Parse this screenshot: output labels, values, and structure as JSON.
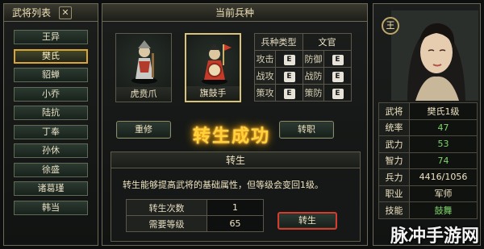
{
  "left_panel": {
    "title": "武将列表",
    "close": "✕",
    "generals": [
      "王异",
      "樊氏",
      "貂蝉",
      "小乔",
      "陆抗",
      "丁奉",
      "孙休",
      "徐盛",
      "诸葛瑾",
      "韩当"
    ],
    "selected_index": 1
  },
  "center_panel": {
    "title": "当前兵种",
    "unit_cards": [
      {
        "label": "虎贲爪",
        "selected": false
      },
      {
        "label": "旗鼓手",
        "selected": true
      }
    ],
    "unit_type_label": "兵种类型",
    "unit_type_value": "文官",
    "stats": [
      {
        "label": "攻击",
        "grade": "E"
      },
      {
        "label": "防御",
        "grade": "E"
      },
      {
        "label": "战攻",
        "grade": "E"
      },
      {
        "label": "战防",
        "grade": "E"
      },
      {
        "label": "策攻",
        "grade": "E"
      },
      {
        "label": "策防",
        "grade": "E"
      }
    ],
    "restudy_label": "重修",
    "change_job_label": "转职",
    "banner": "转生成功",
    "reborn": {
      "title": "转生",
      "description": "转生能够提高武将的基础属性，但等级会变回1级。",
      "rows": [
        {
          "key": "转生次数",
          "value": "1"
        },
        {
          "key": "需要等级",
          "value": "65"
        }
      ],
      "button_label": "转生"
    }
  },
  "right_panel": {
    "emblem": "王",
    "info": [
      {
        "key": "武将",
        "value": "樊氏1级"
      },
      {
        "key": "统率",
        "value": "47"
      },
      {
        "key": "武力",
        "value": "53"
      },
      {
        "key": "智力",
        "value": "74"
      },
      {
        "key": "兵力",
        "value": "4416/1056"
      },
      {
        "key": "职业",
        "value": "军师"
      },
      {
        "key": "技能",
        "value": "鼓舞"
      }
    ],
    "green_color": "#7fd36a"
  },
  "watermark": "脉冲手游网"
}
